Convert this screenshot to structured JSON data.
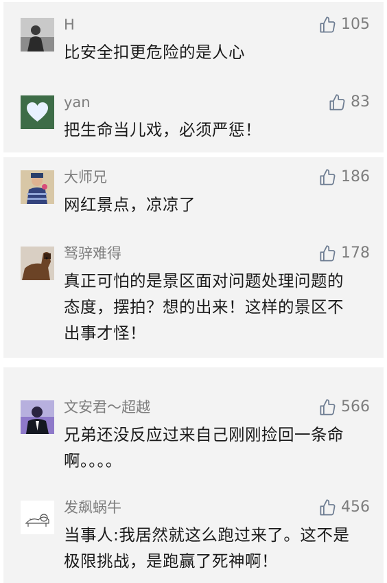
{
  "comments": [
    {
      "user": "H",
      "text": "比安全扣更危险的是人心",
      "likes": "105"
    },
    {
      "user": "yan",
      "text": "把生命当儿戏，必须严惩！",
      "likes": "83"
    },
    {
      "user": "大师兄",
      "text": "网红景点，凉凉了",
      "likes": "186"
    },
    {
      "user": "驽骍难得",
      "text": "真正可怕的是景区面对问题处理问题的\n态度，摆拍？想的出来！这样的景区不\n出事才怪！",
      "likes": "178"
    },
    {
      "user": "文安君～超越",
      "text": "兄弟还没反应过来自己刚刚捡回一条命\n啊。。。。",
      "likes": "566"
    },
    {
      "user": "发飙蜗牛",
      "text": "当事人:我居然就这么跑过来了。这不是\n极限挑战，是跑赢了死神啊！",
      "likes": "456"
    }
  ],
  "colors": {
    "card_bg": "#f3f3f3",
    "text": "#1b1b1b",
    "meta": "#7d7d7d",
    "like_icon": "#6e7d92"
  },
  "icons": {
    "like": "thumbs-up-icon"
  }
}
